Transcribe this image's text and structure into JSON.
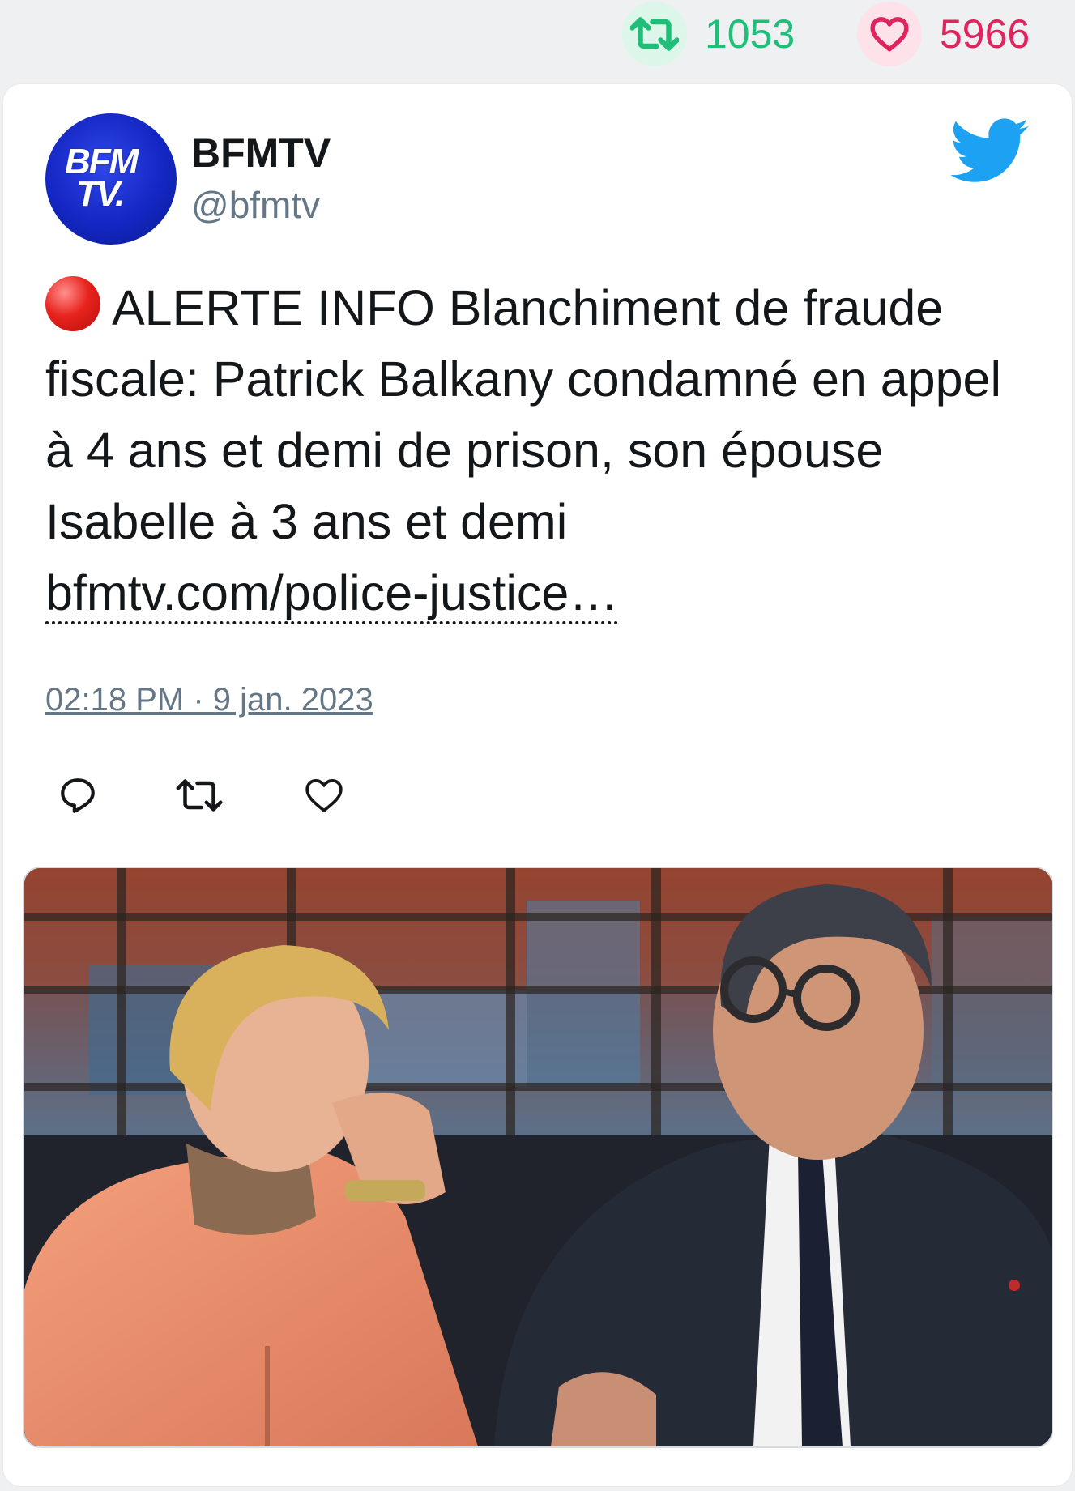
{
  "stats": {
    "retweet_count": "1053",
    "like_count": "5966",
    "retweet_icon": "retweet-icon",
    "like_icon": "heart-icon",
    "retweet_color": "#1fbf7a",
    "like_color": "#e0245e"
  },
  "tweet": {
    "author": {
      "display_name": "BFMTV",
      "handle": "@bfmtv",
      "avatar_line1": "BFM",
      "avatar_line2": "TV."
    },
    "text": "ALERTE INFO Blanchiment de fraude fiscale: Patrick Balkany condamné en appel à 4 ans et demi de prison, son épouse Isabelle à 3 ans et demi",
    "link_text": "bfmtv.com/police-justice…",
    "timestamp": "02:18 PM · 9 jan. 2023",
    "brand_icon": "twitter-bird-icon",
    "brand_color": "#1da1f2"
  },
  "actions": {
    "reply_icon": "reply-icon",
    "retweet_icon": "retweet-icon",
    "like_icon": "heart-icon"
  },
  "media": {
    "kind": "photo"
  }
}
